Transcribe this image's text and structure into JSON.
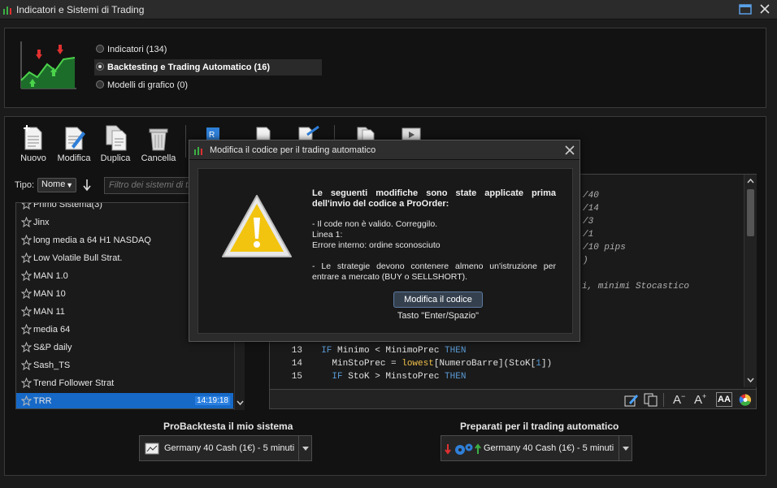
{
  "window": {
    "title": "Indicatori e Sistemi di Trading"
  },
  "categories": [
    {
      "label": "Indicatori (134)",
      "selected": false
    },
    {
      "label": "Backtesting e Trading Automatico (16)",
      "selected": true
    },
    {
      "label": "Modelli di grafico (0)",
      "selected": false
    }
  ],
  "toolbar": {
    "new_label": "Nuovo",
    "edit_label": "Modifica",
    "duplicate_label": "Duplica",
    "delete_label": "Cancella"
  },
  "filter": {
    "type_label": "Tipo:",
    "type_value": "Nome",
    "search_placeholder": "Filtro dei sistemi di tr"
  },
  "systems": {
    "partial_top": "Primo Sistema(3)",
    "items": [
      {
        "name": "Jinx"
      },
      {
        "name": "long media a 64 H1 NASDAQ"
      },
      {
        "name": "Low Volatile Bull Strat."
      },
      {
        "name": "MAN 1.0"
      },
      {
        "name": "MAN 10"
      },
      {
        "name": "MAN 11"
      },
      {
        "name": "media 64"
      },
      {
        "name": "S&P daily"
      },
      {
        "name": "Sash_TS"
      },
      {
        "name": "Trend Follower Strat"
      },
      {
        "name": "TRR",
        "time": "14:19:18",
        "selected": true
      }
    ]
  },
  "code": {
    "right_fragments": [
      "/40",
      "/14",
      "/3",
      "/1",
      "/10 pips",
      ")",
      "i, minimi Stocastico"
    ],
    "lines": [
      {
        "num": "13",
        "indent": "  ",
        "parts": [
          [
            "kw",
            "IF "
          ],
          [
            "",
            "Minimo < MinimoPrec "
          ],
          [
            "kw",
            "THEN"
          ]
        ]
      },
      {
        "num": "14",
        "indent": "    ",
        "parts": [
          [
            "",
            "MinStoPrec = "
          ],
          [
            "fn",
            "lowest"
          ],
          [
            "",
            "[NumeroBarre](StoK["
          ],
          [
            "kw",
            "1"
          ],
          [
            "",
            "])"
          ]
        ]
      },
      {
        "num": "15",
        "indent": "    ",
        "parts": [
          [
            "kw",
            "IF "
          ],
          [
            "",
            "StoK > MinstoPrec "
          ],
          [
            "kw",
            "THEN"
          ]
        ]
      }
    ]
  },
  "bottom": {
    "backtest_title": "ProBacktesta il mio sistema",
    "backtest_instrument": "Germany 40 Cash (1€) - 5 minuti",
    "auto_title": "Preparati per il trading automatico",
    "auto_instrument": "Germany 40 Cash (1€) - 5 minuti"
  },
  "modal": {
    "title": "Modifica il codice per il trading automatico",
    "heading": "Le seguenti modifiche sono state applicate prima dell'invio del codice a ProOrder:",
    "line1": "- Il code non è valido. Correggilo.",
    "line2": "Linea 1:",
    "line3": "Errore interno: ordine sconosciuto",
    "line4": "- Le strategie devono contenere almeno un'istruzione per entrare a mercato (BUY o SELLSHORT).",
    "button": "Modifica il codice",
    "hint": "Tasto \"Enter/Spazio\""
  },
  "colors": {
    "accent": "#1769c7",
    "warning": "#f2c40f",
    "up": "#2ea043",
    "down": "#e03030"
  }
}
